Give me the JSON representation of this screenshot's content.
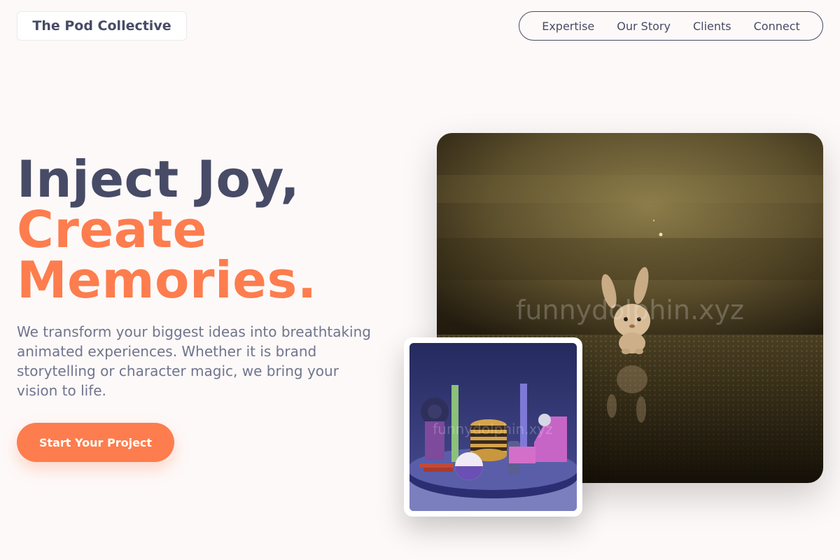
{
  "brand": {
    "name": "The Pod Collective"
  },
  "nav": {
    "items": [
      "Expertise",
      "Our Story",
      "Clients",
      "Connect"
    ]
  },
  "hero": {
    "title_line1": "Inject Joy,",
    "title_line2": "Create",
    "title_line3": "Memories.",
    "description": "We transform your biggest ideas into breathtaking animated experiences. Whether it is brand storytelling or character magic, we bring your vision to life.",
    "cta_label": "Start Your Project"
  },
  "images": {
    "main_watermark": "funnydolphin.xyz",
    "inset_watermark": "funnydolphin.xyz"
  },
  "colors": {
    "accent": "#fd7d4e",
    "text": "#474b66",
    "muted": "#70758d",
    "background": "#fdf9f8"
  }
}
